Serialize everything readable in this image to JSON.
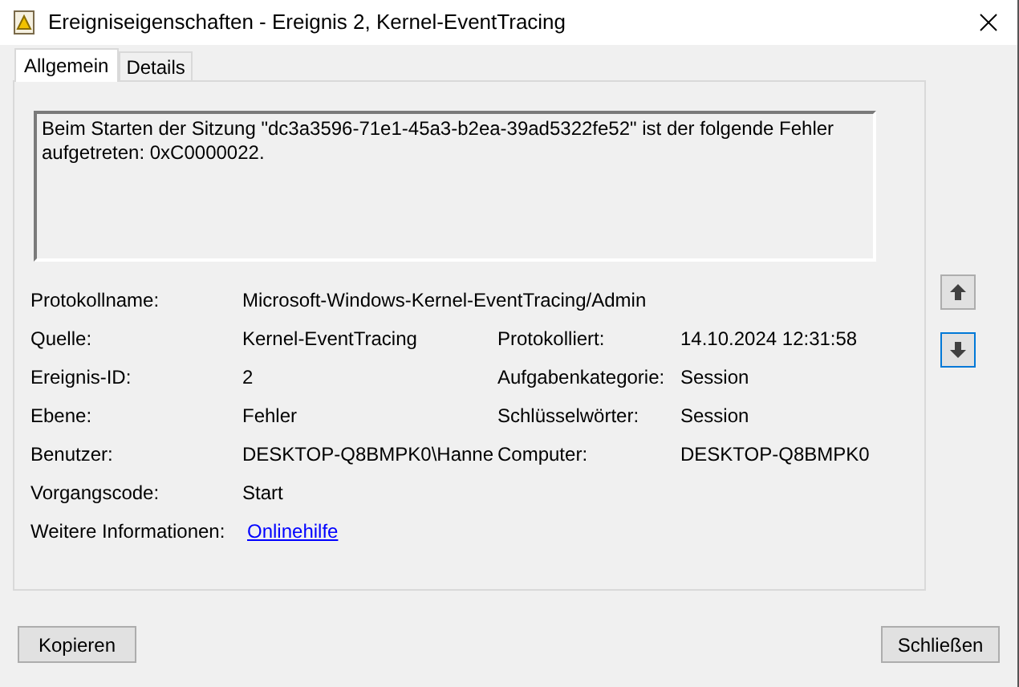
{
  "window": {
    "title": "Ereigniseigenschaften - Ereignis 2, Kernel-EventTracing"
  },
  "tabs": [
    {
      "label": "Allgemein",
      "selected": true
    },
    {
      "label": "Details",
      "selected": false
    }
  ],
  "message": "Beim Starten der Sitzung \"dc3a3596-71e1-45a3-b2ea-39ad5322fe52\" ist der folgende Fehler aufgetreten: 0xC0000022.",
  "fields": [
    {
      "label": "Protokollname:",
      "value": "Microsoft-Windows-Kernel-EventTracing/Admin",
      "kind": "wide"
    },
    {
      "label": "Quelle:",
      "value": "Kernel-EventTracing",
      "label_2": "Protokolliert:",
      "value_2": "14.10.2024 12:31:58",
      "kind": "pair"
    },
    {
      "label": "Ereignis-ID:",
      "value": "2",
      "label_2": "Aufgabenkategorie:",
      "value_2": "Session",
      "kind": "pair"
    },
    {
      "label": "Ebene:",
      "value": "Fehler",
      "label_2": "Schlüsselwörter:",
      "value_2": "Session",
      "kind": "pair"
    },
    {
      "label": "Benutzer:",
      "value": "DESKTOP-Q8BMPK0\\Hanne",
      "label_2": "Computer:",
      "value_2": "DESKTOP-Q8BMPK0",
      "kind": "pair"
    },
    {
      "label": "Vorgangscode:",
      "value": "Start",
      "kind": "single"
    },
    {
      "label": "Weitere Informationen:",
      "value": "Onlinehilfe",
      "kind": "link"
    }
  ],
  "buttons": [
    "Kopieren",
    "Schließen"
  ]
}
